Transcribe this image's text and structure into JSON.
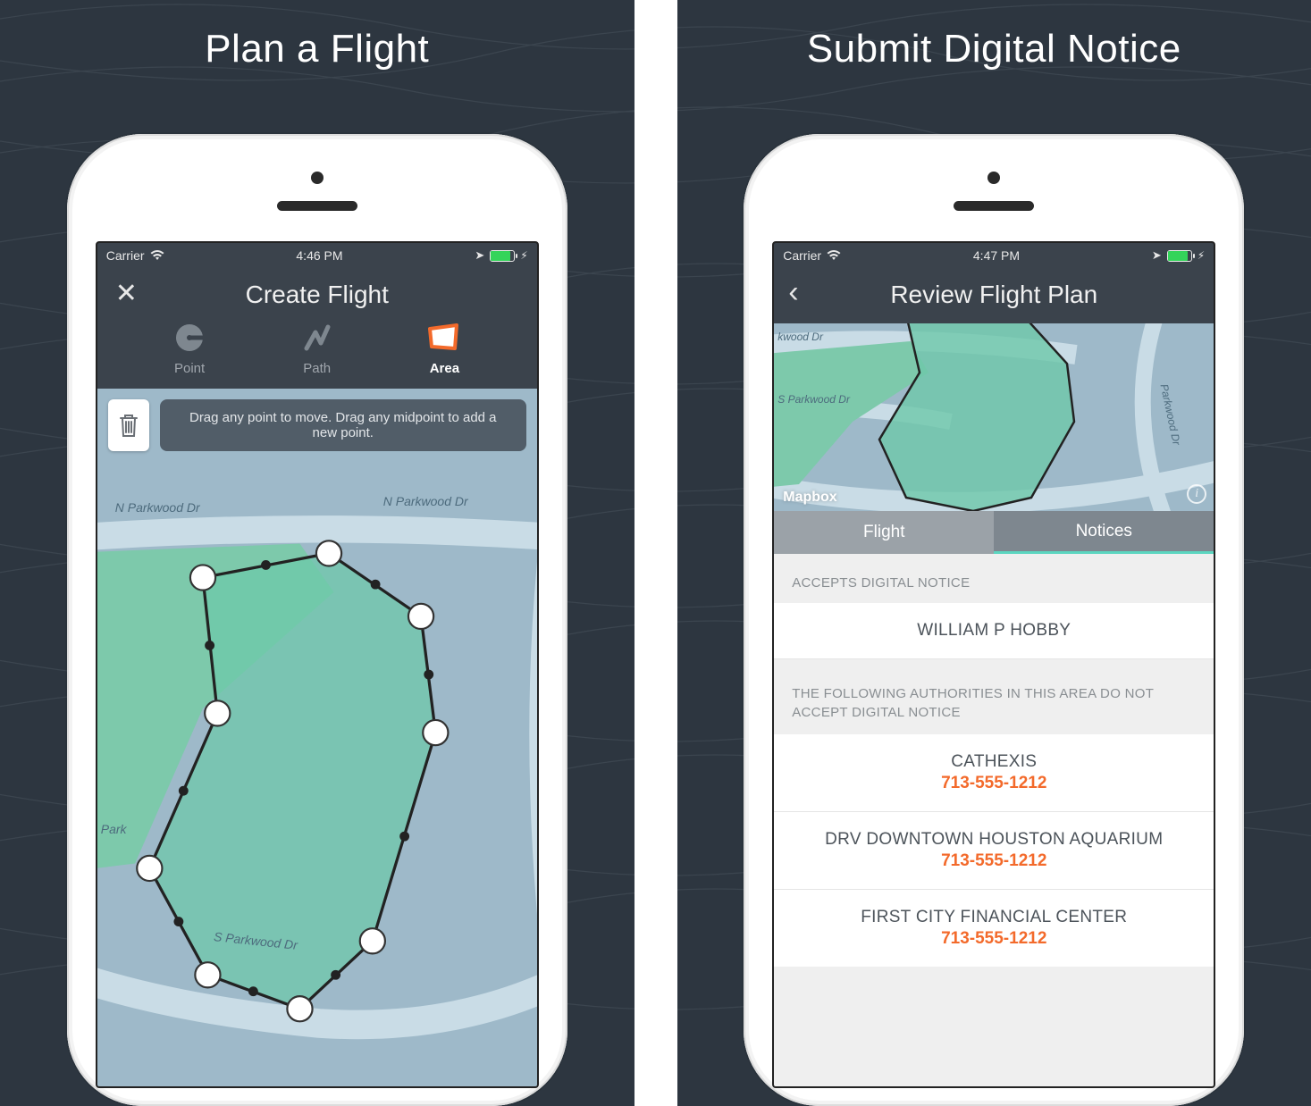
{
  "panelLeft": {
    "title": "Plan a Flight",
    "statusbar": {
      "carrier": "Carrier",
      "time": "4:46 PM"
    },
    "nav": {
      "title": "Create Flight"
    },
    "modes": [
      {
        "label": "Point"
      },
      {
        "label": "Path"
      },
      {
        "label": "Area"
      }
    ],
    "tip": "Drag any point to move. Drag any midpoint to add a new point.",
    "roads": {
      "nParkwood1": "N Parkwood Dr",
      "nParkwood2": "N Parkwood Dr",
      "sParkwood": "S Parkwood Dr",
      "park": "Park"
    }
  },
  "panelRight": {
    "title": "Submit Digital Notice",
    "statusbar": {
      "carrier": "Carrier",
      "time": "4:47 PM"
    },
    "nav": {
      "title": "Review Flight Plan"
    },
    "minimap": {
      "attribution": "Mapbox",
      "roads": {
        "kwood": "kwood Dr",
        "sParkwood": "S Parkwood Dr",
        "parkwood": "Parkwood Dr"
      }
    },
    "tabs": {
      "flight": "Flight",
      "notices": "Notices"
    },
    "sections": {
      "acceptsHeader": "ACCEPTS DIGITAL NOTICE",
      "acceptsName": "WILLIAM P HOBBY",
      "noAcceptHeader": "THE FOLLOWING AUTHORITIES IN THIS AREA DO NOT ACCEPT DIGITAL NOTICE",
      "authorities": [
        {
          "name": "CATHEXIS",
          "phone": "713-555-1212"
        },
        {
          "name": "DRV DOWNTOWN HOUSTON AQUARIUM",
          "phone": "713-555-1212"
        },
        {
          "name": "FIRST CITY FINANCIAL CENTER",
          "phone": "713-555-1212"
        }
      ]
    }
  }
}
